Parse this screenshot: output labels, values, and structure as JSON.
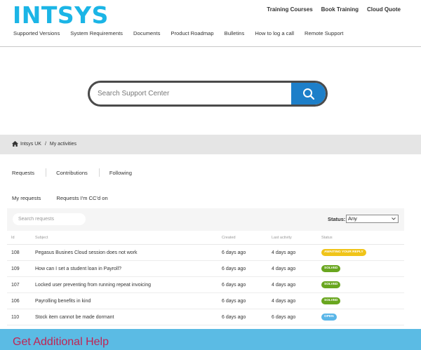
{
  "header": {
    "logo": "INTSYS",
    "top_nav": [
      "Training Courses",
      "Book Training",
      "Cloud Quote"
    ],
    "sub_nav": [
      "Supported Versions",
      "System Requirements",
      "Documents",
      "Product Roadmap",
      "Bulletins",
      "How to log a call",
      "Remote Support"
    ]
  },
  "search": {
    "placeholder": "Search Support Center",
    "icon": "search-icon"
  },
  "breadcrumb": {
    "home_icon": "home-icon",
    "home": "Intsys UK",
    "separator": "/",
    "current": "My activities"
  },
  "tabs": [
    "Requests",
    "Contributions",
    "Following"
  ],
  "subtabs": [
    "My requests",
    "Requests I'm CC'd on"
  ],
  "filter": {
    "placeholder": "Search requests",
    "status_label": "Status:",
    "status_value": "Any"
  },
  "table": {
    "columns": [
      "Id",
      "Subject",
      "Created",
      "Last activity",
      "Status"
    ],
    "rows": [
      {
        "id": "108",
        "subject": "Pegasus Busines Cloud session does not work",
        "created": "6 days ago",
        "last": "4 days ago",
        "status": "Awaiting your reply",
        "status_color": "#f0c419"
      },
      {
        "id": "109",
        "subject": "How can I set a student loan in Payroll?",
        "created": "6 days ago",
        "last": "4 days ago",
        "status": "Solved",
        "status_color": "#69a61f"
      },
      {
        "id": "107",
        "subject": "Locked user preventing from running repeat invoicing",
        "created": "6 days ago",
        "last": "4 days ago",
        "status": "Solved",
        "status_color": "#69a61f"
      },
      {
        "id": "106",
        "subject": "Payrolling benefits in kind",
        "created": "6 days ago",
        "last": "4 days ago",
        "status": "Solved",
        "status_color": "#69a61f"
      },
      {
        "id": "110",
        "subject": "Stock item cannot be made dormant",
        "created": "6 days ago",
        "last": "6 days ago",
        "status": "Open",
        "status_color": "#5ab6e8"
      }
    ]
  },
  "footer": {
    "title": "Get Additional Help"
  },
  "colors": {
    "brand": "#1bb5e6",
    "search_button": "#1d7fc9",
    "footer_band": "#5bbbe4",
    "footer_title": "#c02454"
  }
}
